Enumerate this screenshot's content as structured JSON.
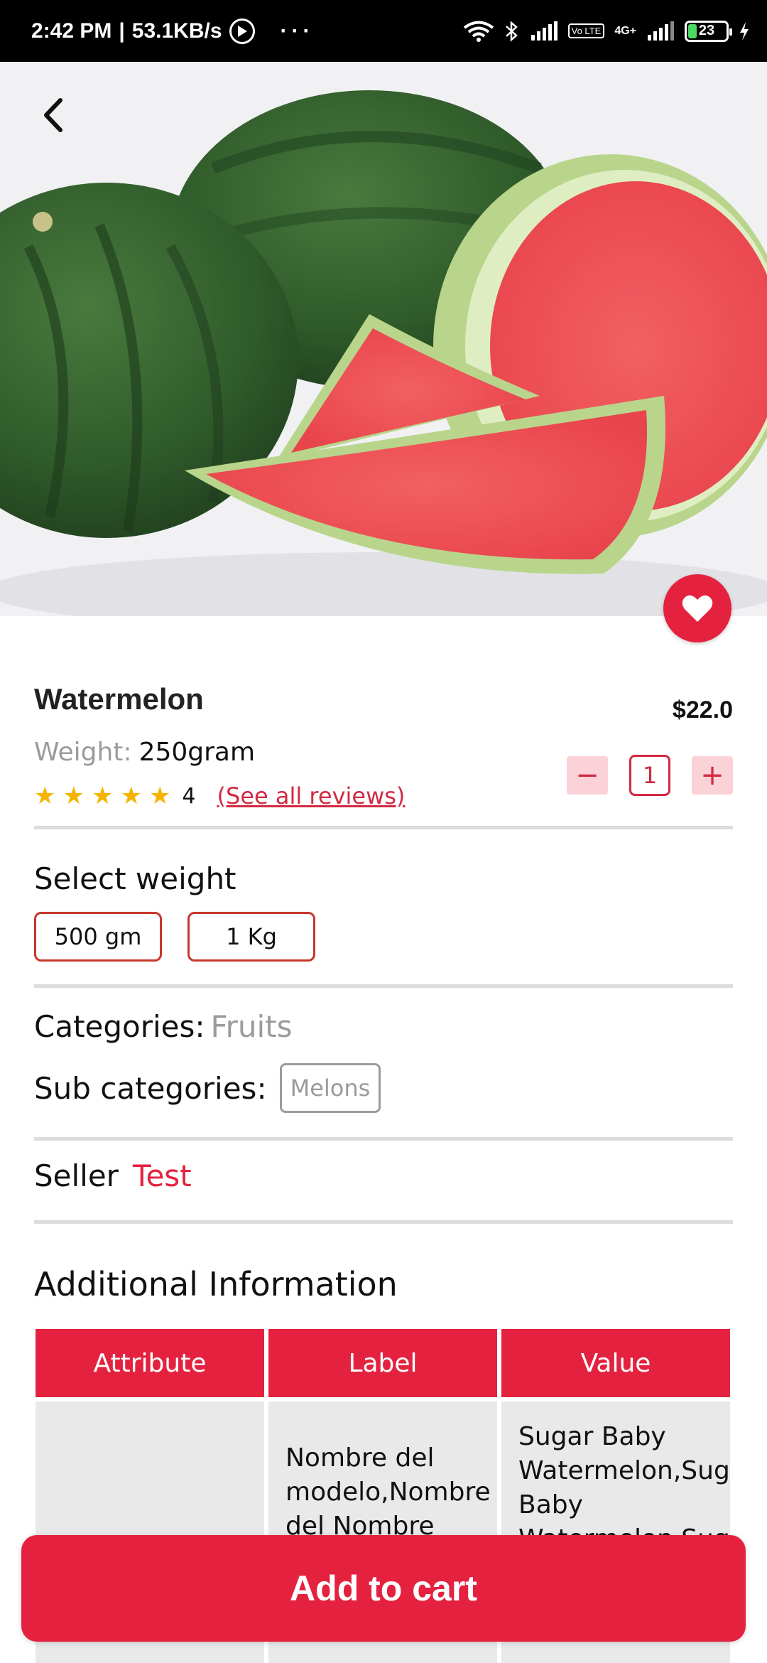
{
  "status_bar": {
    "time": "2:42 PM",
    "speed": "53.1KB/s",
    "dots": "···",
    "network": "4G+",
    "lte": "Vo LTE",
    "battery": "23"
  },
  "product": {
    "name": "Watermelon",
    "price": "$22.0",
    "weight_label": "Weight:",
    "weight_value": "250gram",
    "rating": "4",
    "reviews_link": "(See all reviews)",
    "quantity": "1",
    "minus": "−",
    "plus": "+"
  },
  "select_weight": {
    "title": "Select weight",
    "options": [
      "500 gm",
      "1 Kg"
    ]
  },
  "categories": {
    "label": "Categories:",
    "value": "Fruits",
    "sub_label": "Sub categories:",
    "sub_value": "Melons"
  },
  "seller": {
    "label": "Seller",
    "value": "Test"
  },
  "additional_info": {
    "title": "Additional Information",
    "headers": [
      "Attribute",
      "Label",
      "Value"
    ],
    "row": {
      "attribute": "",
      "label": "Nombre del modelo,Nombre del Nombre del modelo,Nombre del modelo",
      "value": "Sugar Baby Watermelon,Sugar Baby Watermelon,Sugar Baby"
    }
  },
  "add_to_cart": "Add to cart",
  "colors": {
    "accent": "#e4223f",
    "star": "#f5b400",
    "muted": "#9b9b9b"
  }
}
